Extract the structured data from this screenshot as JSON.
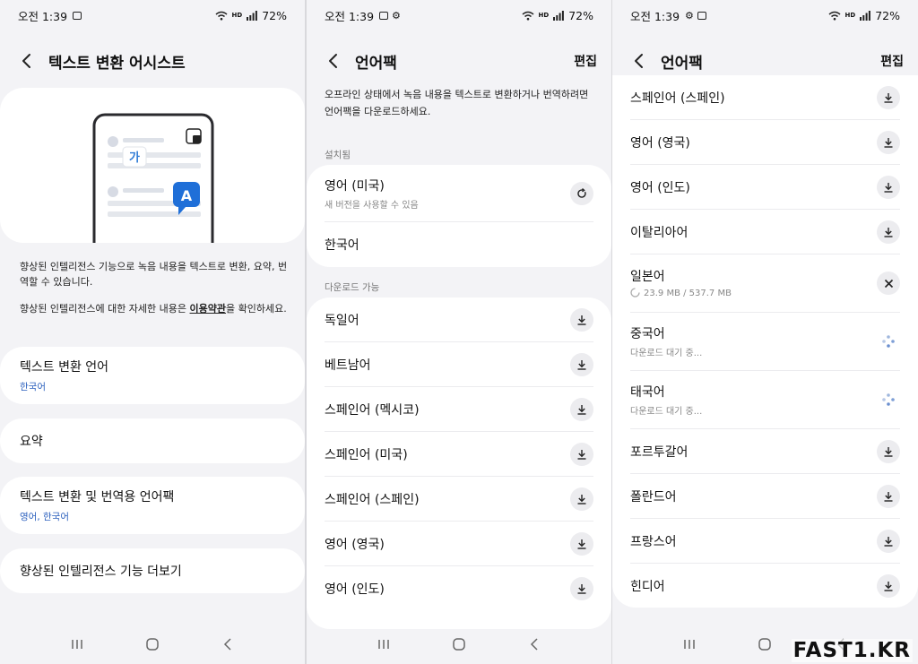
{
  "status_bar": {
    "s1": {
      "time": "오전 1:39",
      "battery": "72%",
      "hd": "HD"
    },
    "s2": {
      "time": "오전 1:39",
      "battery": "72%",
      "hd": "HD"
    },
    "s3": {
      "time": "오전 1:39",
      "battery": "72%",
      "hd": "HD"
    }
  },
  "screen1": {
    "title": "텍스트 변환 어시스트",
    "illustration_char1": "가",
    "illustration_char2": "A",
    "description1": "향상된 인텔리전스 기능으로 녹음 내용을 텍스트로 변환, 요약, 번역할 수 있습니다.",
    "description2_pre": "향상된 인텔리전스에 대한 자세한 내용은 ",
    "description2_link": "이용약관",
    "description2_post": "을 확인하세요.",
    "menu": [
      {
        "title": "텍스트 변환 언어",
        "subtitle": "한국어"
      },
      {
        "title": "요약",
        "subtitle": ""
      },
      {
        "title": "텍스트 변환 및 번역용 언어팩",
        "subtitle": "영어, 한국어"
      },
      {
        "title": "향상된 인텔리전스 기능 더보기",
        "subtitle": ""
      }
    ]
  },
  "screen2": {
    "title": "언어팩",
    "edit_label": "편집",
    "intro": "오프라인 상태에서 녹음 내용을 텍스트로 변환하거나 번역하려면 언어팩을 다운로드하세요.",
    "installed_header": "설치됨",
    "installed": [
      {
        "name": "영어 (미국)",
        "sub": "새 버전을 사용할 수 있음",
        "action": "update-icon"
      },
      {
        "name": "한국어",
        "sub": "",
        "action": ""
      }
    ],
    "available_header": "다운로드 가능",
    "available": [
      {
        "name": "독일어"
      },
      {
        "name": "베트남어"
      },
      {
        "name": "스페인어 (멕시코)"
      },
      {
        "name": "스페인어 (미국)"
      },
      {
        "name": "스페인어 (스페인)"
      },
      {
        "name": "영어 (영국)"
      },
      {
        "name": "영어 (인도)"
      }
    ]
  },
  "screen3": {
    "title": "언어팩",
    "edit_label": "편집",
    "items": [
      {
        "name": "스페인어 (스페인)",
        "sub": "",
        "action": "download-icon"
      },
      {
        "name": "영어 (영국)",
        "sub": "",
        "action": "download-icon"
      },
      {
        "name": "영어 (인도)",
        "sub": "",
        "action": "download-icon"
      },
      {
        "name": "이탈리아어",
        "sub": "",
        "action": "download-icon"
      },
      {
        "name": "일본어",
        "sub": "23.9 MB / 537.7 MB",
        "action": "cancel-icon"
      },
      {
        "name": "중국어",
        "sub": "다운로드 대기 중...",
        "action": "waiting-icon"
      },
      {
        "name": "태국어",
        "sub": "다운로드 대기 중...",
        "action": "waiting-icon"
      },
      {
        "name": "포르투갈어",
        "sub": "",
        "action": "download-icon"
      },
      {
        "name": "폴란드어",
        "sub": "",
        "action": "download-icon"
      },
      {
        "name": "프랑스어",
        "sub": "",
        "action": "download-icon"
      },
      {
        "name": "힌디어",
        "sub": "",
        "action": "download-icon"
      }
    ]
  },
  "watermark": "FAST1.KR",
  "colors": {
    "accent_link": "#2a5fbd",
    "wave_teal": "#2bc3b4",
    "wave_blue": "#2e7bd6",
    "background": "#f3f3f6",
    "card": "#ffffff"
  }
}
